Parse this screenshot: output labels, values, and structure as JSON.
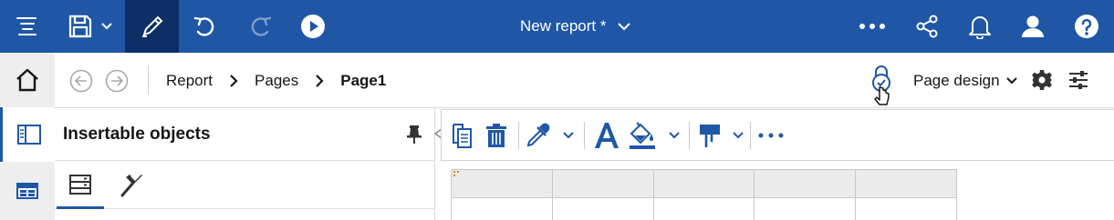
{
  "header": {
    "report_title": "New report *",
    "menu_icon": "menu-lines-icon",
    "save_icon": "floppy-save-icon",
    "edit_icon": "pencil-edit-icon",
    "undo_icon": "undo-icon",
    "redo_icon": "redo-icon",
    "run_icon": "play-run-icon",
    "more_icon": "ellipsis-icon",
    "share_icon": "share-icon",
    "notifications_icon": "bell-icon",
    "user_icon": "user-icon",
    "help_icon": "help-icon",
    "colors": {
      "bar": "#1f57a6",
      "active": "#0e2f66"
    }
  },
  "rail": {
    "items": [
      {
        "name": "home",
        "icon": "home-icon"
      },
      {
        "name": "insertable-objects",
        "icon": "panel-toggle-icon",
        "active": true
      },
      {
        "name": "data",
        "icon": "data-sources-icon"
      }
    ]
  },
  "breadcrumb": {
    "items": [
      "Report",
      "Pages",
      "Page1"
    ],
    "current_index": 2,
    "view_mode": "Page design"
  },
  "panel": {
    "title": "Insertable objects",
    "tabs": [
      {
        "name": "toolbox",
        "icon": "toolbox-icon",
        "active": true
      },
      {
        "name": "tools",
        "icon": "hammer-icon",
        "active": false
      }
    ]
  },
  "toolbar": {
    "tools": [
      {
        "name": "copy",
        "icon": "copy-icon"
      },
      {
        "name": "delete",
        "icon": "trash-icon"
      },
      {
        "name": "background-color",
        "icon": "eyedropper-icon",
        "dropdown": true
      },
      {
        "name": "font",
        "icon": "font-a-icon"
      },
      {
        "name": "fill",
        "icon": "paint-bucket-icon",
        "dropdown": true
      },
      {
        "name": "pin",
        "icon": "pin-flag-icon",
        "dropdown": true
      },
      {
        "name": "more",
        "icon": "ellipsis-icon"
      }
    ]
  },
  "canvas": {
    "table": {
      "columns": 5,
      "rows": 2
    }
  }
}
